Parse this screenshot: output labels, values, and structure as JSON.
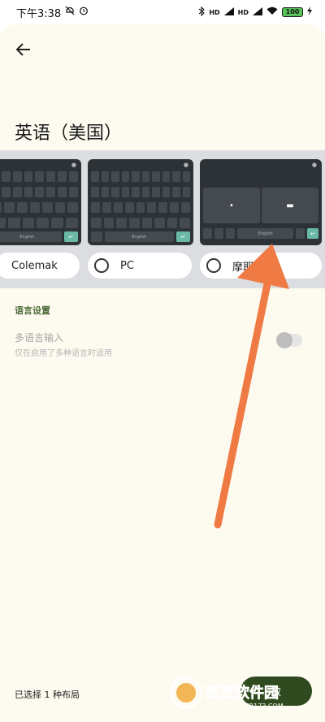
{
  "status_bar": {
    "time": "下午3:38",
    "network_1": "HD",
    "network_2": "HD",
    "battery": "100"
  },
  "header": {
    "back_icon": "arrow-left-icon",
    "title": "英语（美国）"
  },
  "layouts": [
    {
      "label": "Colemak",
      "selected": false
    },
    {
      "label": "PC",
      "selected": false
    },
    {
      "label": "摩耶",
      "selected": false
    }
  ],
  "keyboard": {
    "space_label": "English",
    "enter_glyph": "↵"
  },
  "settings": {
    "section_label": "语言设置",
    "multi_title": "多语言输入",
    "multi_subtitle": "仅在启用了多种语言时适用",
    "multi_enabled": false
  },
  "footer": {
    "selected_text": "已选择 1 种布局",
    "confirm_label": "取"
  },
  "watermark": {
    "brand": "西西软件园",
    "site": "CR173.COM"
  },
  "colors": {
    "sheet_bg": "#fdfbf0",
    "carousel_bg": "#dcdde0",
    "keyboard_bg": "#2d3236",
    "accent_green": "#4f6d3a",
    "enter_key": "#69b9a6",
    "arrow": "#f07a43"
  }
}
